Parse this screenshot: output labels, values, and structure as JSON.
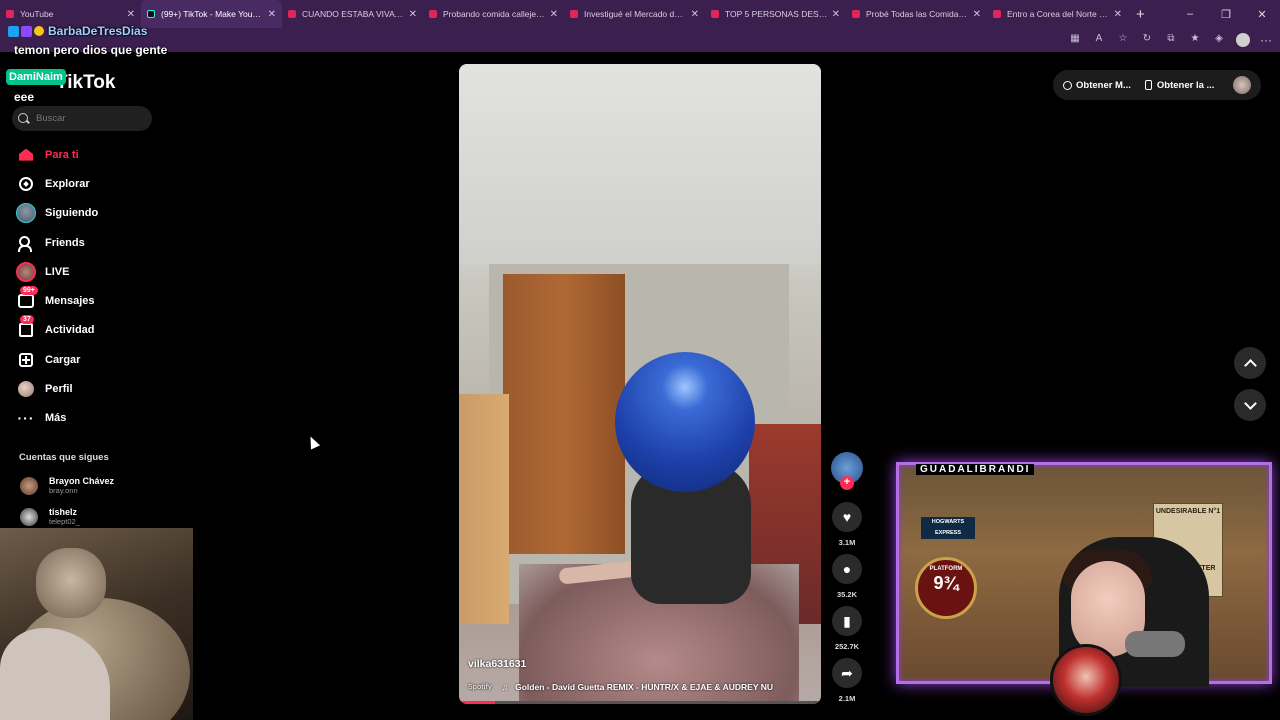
{
  "browser": {
    "tabs": [
      {
        "title": "YouTube",
        "active": false,
        "icon": "youtube-icon"
      },
      {
        "title": "(99+) TikTok - Make Your Day",
        "active": true,
        "icon": "tiktok-icon"
      },
      {
        "title": "CUANDO ESTABA VIVA a NA",
        "active": false,
        "icon": "youtube-icon"
      },
      {
        "title": "Probando comida callejera e",
        "active": false,
        "icon": "youtube-icon"
      },
      {
        "title": "Investigué el Mercado de Ar",
        "active": false,
        "icon": "youtube-icon"
      },
      {
        "title": "TOP 5 PERSONAS DESINFOR",
        "active": false,
        "icon": "youtube-icon"
      },
      {
        "title": "Probé Todas las Comidas XX",
        "active": false,
        "icon": "youtube-icon"
      },
      {
        "title": "Entro a Corea del Norte - Yo",
        "active": false,
        "icon": "youtube-icon"
      }
    ],
    "new_tab": "+",
    "window_controls": [
      "–",
      "❐",
      "✕"
    ],
    "toolbar_icons": [
      "app-icon",
      "translate-icon",
      "star-icon",
      "refresh-icon",
      "extensions-icon",
      "favorites-icon",
      "shield-icon"
    ],
    "more": "···"
  },
  "sidebar": {
    "logo": "TikTok",
    "search_placeholder": "Buscar",
    "nav": [
      {
        "label": "Para ti",
        "icon": "home-icon",
        "active": true
      },
      {
        "label": "Explorar",
        "icon": "compass-icon"
      },
      {
        "label": "Siguiendo",
        "icon": "following-avatar-icon"
      },
      {
        "label": "Friends",
        "icon": "friends-icon"
      },
      {
        "label": "LIVE",
        "icon": "live-icon"
      },
      {
        "label": "Mensajes",
        "icon": "message-icon",
        "badge": "99+"
      },
      {
        "label": "Actividad",
        "icon": "activity-icon",
        "badge": "37"
      },
      {
        "label": "Cargar",
        "icon": "upload-icon"
      },
      {
        "label": "Perfil",
        "icon": "profile-icon"
      },
      {
        "label": "Más",
        "icon": "more-icon"
      }
    ],
    "following_title": "Cuentas que sigues",
    "following": [
      {
        "name": "Brayon Chávez",
        "handle": "bray.onn"
      },
      {
        "name": "tishelz",
        "handle": "telept02_"
      }
    ]
  },
  "stream_chat": {
    "user1": "BarbaDeTresDias",
    "msg1": "temon pero dios que gente",
    "user2": "DamiNaim",
    "msg2": "eee"
  },
  "video": {
    "username": "vilka631631",
    "source": "Spotify",
    "music": "Golden - David Guetta REMIX - HUNTR/X & EJAE & AUDREY NU",
    "progress": 0.1
  },
  "actions": {
    "likes": "3.1M",
    "comments": "35.2K",
    "saves": "252.7K",
    "shares": "2.1M"
  },
  "topbar": {
    "get_coins": "Obtener M...",
    "get_app": "Obtener la ..."
  },
  "webcam": {
    "label": "GUADALIBRANDI",
    "poster_title": "UNDESIRABLE N°1",
    "poster_name": "HARRY POTTER",
    "hogwarts": "HOGWARTS EXPRESS",
    "platform": "PLATFORM",
    "platform_no": "9¾"
  },
  "colors": {
    "accent": "#fe2c55",
    "frame": "#b46ee6",
    "tabbar": "#3a1f4f"
  }
}
